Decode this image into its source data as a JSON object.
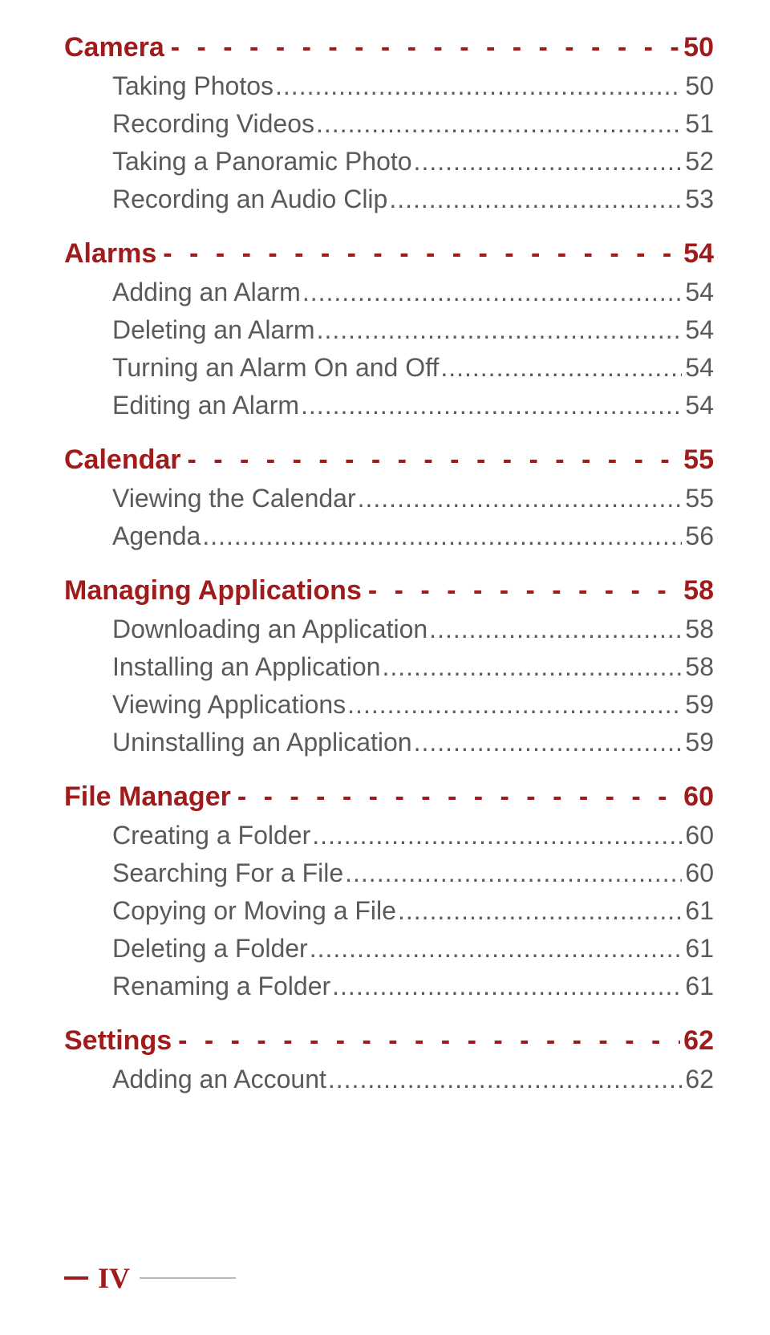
{
  "sections": [
    {
      "title": "Camera",
      "page": "50",
      "items": [
        {
          "title": "Taking Photos",
          "page": "50"
        },
        {
          "title": "Recording Videos",
          "page": "51"
        },
        {
          "title": "Taking a Panoramic Photo",
          "page": "52"
        },
        {
          "title": "Recording an Audio Clip",
          "page": "53"
        }
      ]
    },
    {
      "title": "Alarms",
      "page": "54",
      "items": [
        {
          "title": "Adding an Alarm",
          "page": "54"
        },
        {
          "title": "Deleting an Alarm",
          "page": "54"
        },
        {
          "title": "Turning an Alarm On and Off",
          "page": "54"
        },
        {
          "title": "Editing an Alarm",
          "page": "54"
        }
      ]
    },
    {
      "title": "Calendar",
      "page": "55",
      "items": [
        {
          "title": "Viewing the Calendar",
          "page": "55"
        },
        {
          "title": "Agenda",
          "page": "56"
        }
      ]
    },
    {
      "title": "Managing Applications",
      "page": "58",
      "items": [
        {
          "title": "Downloading an Application",
          "page": "58"
        },
        {
          "title": "Installing an Application",
          "page": "58"
        },
        {
          "title": "Viewing Applications",
          "page": "59"
        },
        {
          "title": "Uninstalling an Application",
          "page": "59"
        }
      ]
    },
    {
      "title": "File Manager",
      "page": "60",
      "items": [
        {
          "title": "Creating a Folder",
          "page": "60"
        },
        {
          "title": "Searching For a File",
          "page": "60"
        },
        {
          "title": "Copying or Moving a File",
          "page": "61"
        },
        {
          "title": "Deleting a Folder",
          "page": "61"
        },
        {
          "title": "Renaming a Folder",
          "page": "61"
        }
      ]
    },
    {
      "title": "Settings",
      "page": "62",
      "items": [
        {
          "title": "Adding an Account",
          "page": "62"
        }
      ]
    }
  ],
  "footer": "IV",
  "fill": {
    "dashes": "- - - - - - - - - - - - - - - - - - - - - - - - - - - - - - - - - - - - - - - -",
    "dots": "........................................................................................................."
  }
}
